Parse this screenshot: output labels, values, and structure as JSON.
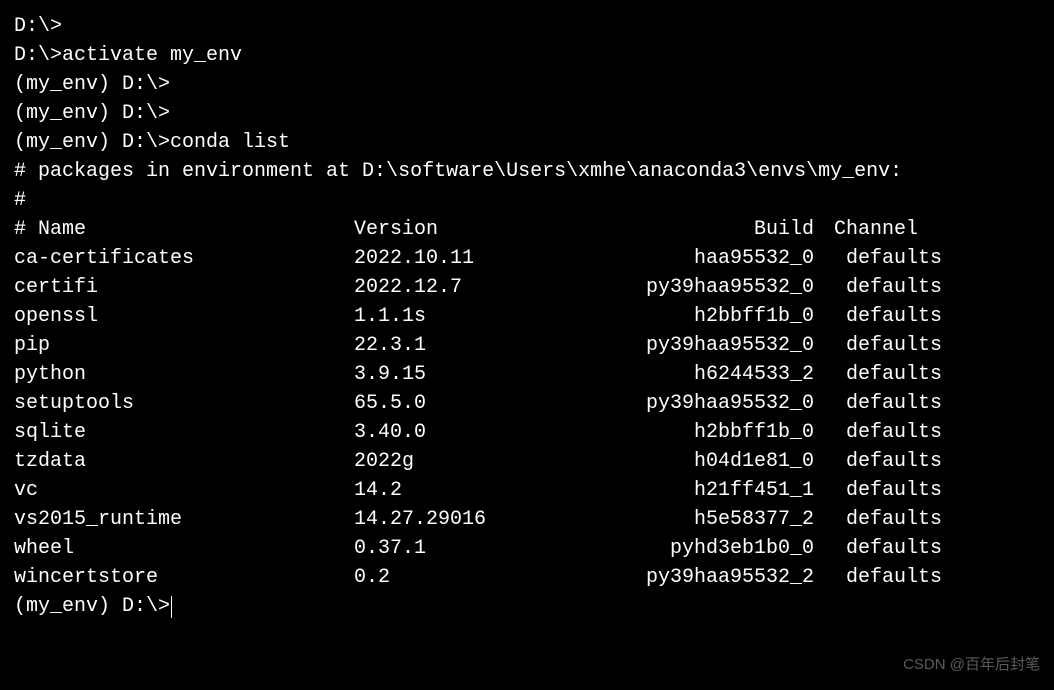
{
  "lines": {
    "prompt1": "D:\\>",
    "prompt2_cmd": "D:\\>activate my_env",
    "blank": "",
    "prompt3": "(my_env) D:\\>",
    "prompt4": "(my_env) D:\\>",
    "prompt5_cmd": "(my_env) D:\\>conda list",
    "comment1": "# packages in environment at D:\\software\\Users\\xmhe\\anaconda3\\envs\\my_env:",
    "comment2": "#",
    "final_prompt": "(my_env) D:\\>"
  },
  "header": {
    "name": "# Name",
    "version": "Version",
    "build": "Build",
    "channel": "Channel"
  },
  "packages": [
    {
      "name": "ca-certificates",
      "version": "2022.10.11",
      "build": "haa95532_0",
      "channel": "defaults"
    },
    {
      "name": "certifi",
      "version": "2022.12.7",
      "build": "py39haa95532_0",
      "channel": "defaults"
    },
    {
      "name": "openssl",
      "version": "1.1.1s",
      "build": "h2bbff1b_0",
      "channel": "defaults"
    },
    {
      "name": "pip",
      "version": "22.3.1",
      "build": "py39haa95532_0",
      "channel": "defaults"
    },
    {
      "name": "python",
      "version": "3.9.15",
      "build": "h6244533_2",
      "channel": "defaults"
    },
    {
      "name": "setuptools",
      "version": "65.5.0",
      "build": "py39haa95532_0",
      "channel": "defaults"
    },
    {
      "name": "sqlite",
      "version": "3.40.0",
      "build": "h2bbff1b_0",
      "channel": "defaults"
    },
    {
      "name": "tzdata",
      "version": "2022g",
      "build": "h04d1e81_0",
      "channel": "defaults"
    },
    {
      "name": "vc",
      "version": "14.2",
      "build": "h21ff451_1",
      "channel": "defaults"
    },
    {
      "name": "vs2015_runtime",
      "version": "14.27.29016",
      "build": "h5e58377_2",
      "channel": "defaults"
    },
    {
      "name": "wheel",
      "version": "0.37.1",
      "build": "pyhd3eb1b0_0",
      "channel": "defaults"
    },
    {
      "name": "wincertstore",
      "version": "0.2",
      "build": "py39haa95532_2",
      "channel": "defaults"
    }
  ],
  "watermark": "CSDN @百年后封笔"
}
